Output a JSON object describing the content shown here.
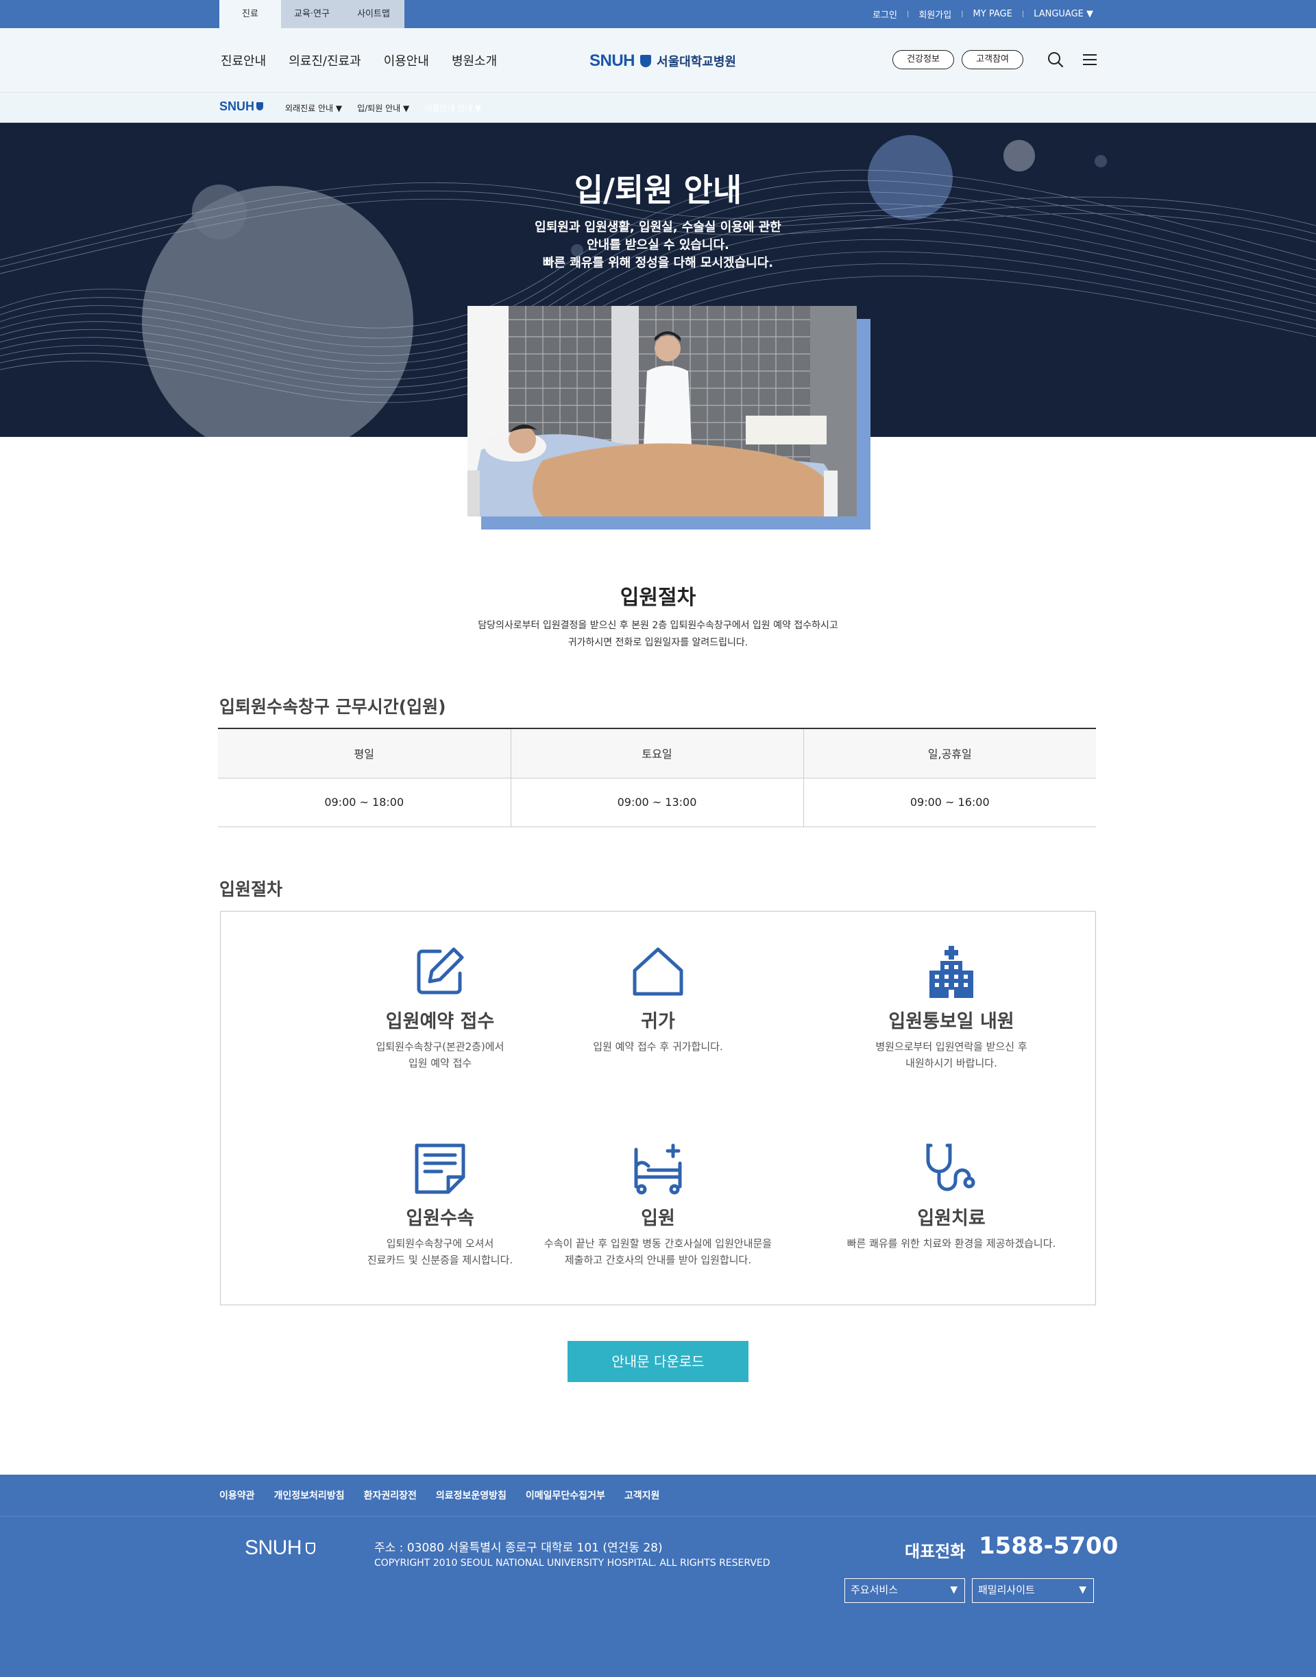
{
  "topbar": {
    "tabs": [
      "진료",
      "교육·연구",
      "사이트맵"
    ],
    "util": [
      "로그인",
      "회원가입",
      "MY PAGE",
      "LANGUAGE ▼"
    ]
  },
  "header": {
    "gnb": [
      "진료안내",
      "의료진/진료과",
      "이용안내",
      "병원소개"
    ],
    "logo_en": "SNUH",
    "logo_ko": "서울대학교병원",
    "pill_health": "건강정보",
    "pill_customer": "고객참여"
  },
  "subnav": {
    "logo": "SNUH",
    "items": [
      "외래진료 안내 ▼",
      "입/퇴원 안내 ▼",
      "이용안내 안내 ▼"
    ]
  },
  "hero": {
    "title": "입/퇴원 안내",
    "desc_line1": "입퇴원과 입원생활, 입원실, 수술실 이용에 관한",
    "desc_line2": "안내를 받으실 수 있습니다.",
    "desc_line3": "빠른 쾌유를 위해 정성을 다해 모시겠습니다."
  },
  "intro": {
    "title": "입원절차",
    "desc_line1": "담당의사로부터 입원결정을 받으신 후 본원 2층 입퇴원수속창구에서 입원 예약 접수하시고",
    "desc_line2": "귀가하시면 전화로 입원일자를 알려드립니다."
  },
  "hours": {
    "heading": "입퇴원수속창구 근무시간(입원)",
    "headers": [
      "평일",
      "토요일",
      "일,공휴일"
    ],
    "values": [
      "09:00 ~ 18:00",
      "09:00 ~ 13:00",
      "09:00 ~ 16:00"
    ]
  },
  "steps": {
    "heading": "입원절차",
    "items": [
      {
        "icon": "edit-icon",
        "title": "입원예약 접수",
        "text": "입퇴원수속창구(본관2층)에서\n입원 예약 접수"
      },
      {
        "icon": "home-icon",
        "title": "귀가",
        "text": "입원 예약 접수 후 귀가합니다."
      },
      {
        "icon": "hospital-icon",
        "title": "입원통보일 내원",
        "text": "병원으로부터 입원연락을 받으신 후\n내원하시기 바랍니다."
      },
      {
        "icon": "document-icon",
        "title": "입원수속",
        "text": "입퇴원수속창구에 오셔서\n진료카드 및 신분증을 제시합니다."
      },
      {
        "icon": "bed-icon",
        "title": "입원",
        "text": "수속이 끝난 후 입원할 병동 간호사실에 입원안내문을\n제출하고 간호사의 안내를 받아 입원합니다."
      },
      {
        "icon": "stethoscope-icon",
        "title": "입원치료",
        "text": "빠른 쾌유를 위한 치료와 환경을 제공하겠습니다."
      }
    ]
  },
  "download_label": "안내문 다운로드",
  "footer": {
    "links": [
      "이용약관",
      "개인정보처리방침",
      "환자권리장전",
      "의료정보운영방침",
      "이메일무단수집거부",
      "고객지원"
    ],
    "logo": "SNUH",
    "address": "주소 : 03080 서울특별시 종로구 대학로 101 (연건동 28)",
    "copyright": "COPYRIGHT 2010 SEOUL NATIONAL UNIVERSITY HOSPITAL. ALL RIGHTS RESERVED",
    "tel_label": "대표전화",
    "tel": "1588-5700",
    "select1": "주요서비스",
    "select2": "패밀리사이트"
  },
  "colors": {
    "brand_blue": "#4272b8",
    "navy": "#15223a",
    "icon_blue": "#2f63b0",
    "button_teal": "#2fb2c6"
  }
}
